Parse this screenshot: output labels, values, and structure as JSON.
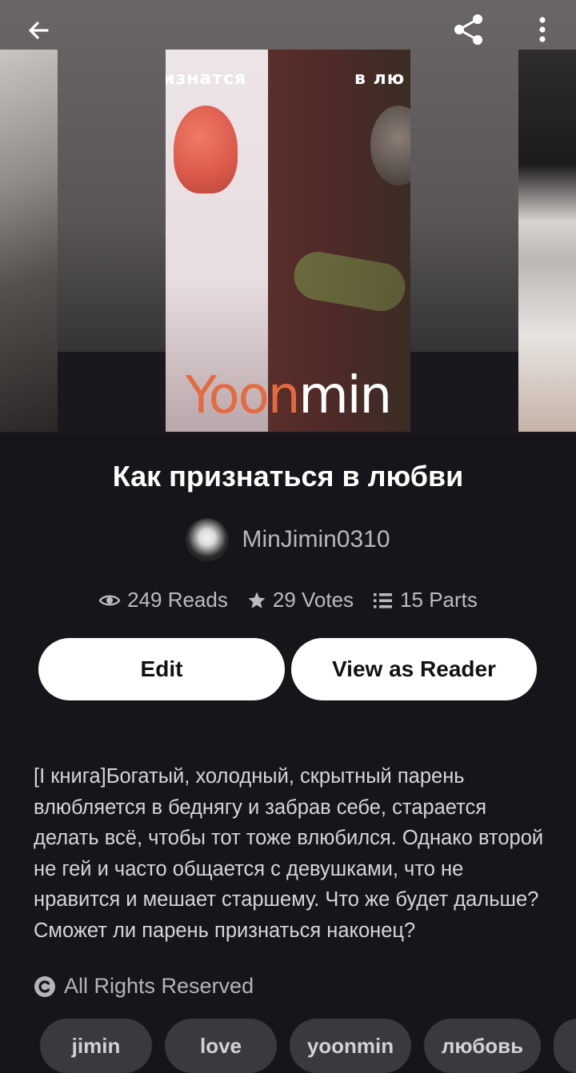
{
  "colors": {
    "background": "#171519",
    "button_bg": "#ffffff",
    "tag_bg": "#3b393d"
  },
  "topbar": {
    "back_icon": "arrow-left-icon",
    "share_icon": "share-icon",
    "more_icon": "more-vertical-icon"
  },
  "cover": {
    "top_left_text": "изнатся",
    "top_right_text": "в лю",
    "title_orange": "Yoon",
    "title_white": "min"
  },
  "story": {
    "title": "Как признаться в любви",
    "author": "MinJimin0310",
    "stats": {
      "reads": "249 Reads",
      "votes": "29 Votes",
      "parts": "15 Parts"
    },
    "description": "[I книга]Богатый, холодный, скрытный парень влюбляется в беднягу и забрав себе, старается делать всё, чтобы тот тоже влюбился. Однако второй не гей и часто общается с девушками, что не нравится и мешает старшему. Что же будет дальше? Сможет ли парень признаться наконец?",
    "rights": "All Rights Reserved",
    "tags": [
      "jimin",
      "love",
      "yoonmin",
      "любовь"
    ]
  },
  "actions": {
    "edit_label": "Edit",
    "view_label": "View as Reader"
  }
}
